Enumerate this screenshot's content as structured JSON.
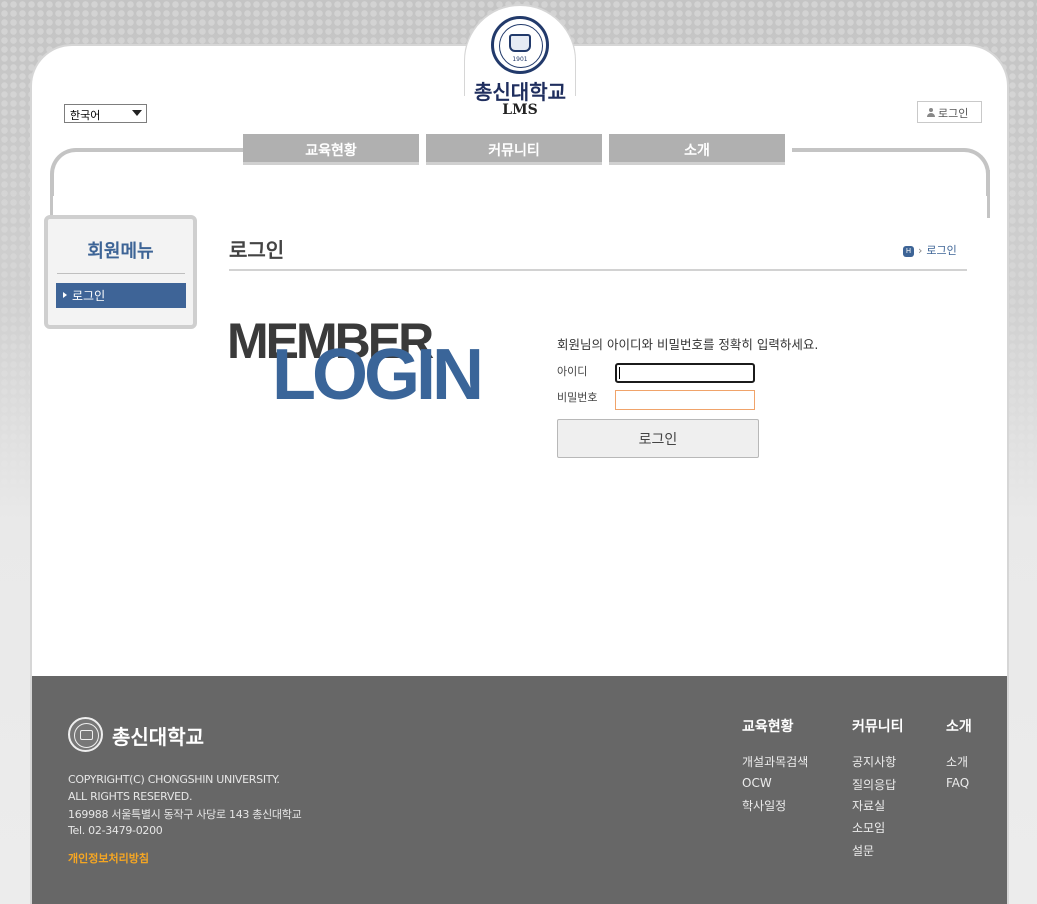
{
  "header": {
    "university_name": "총신대학교",
    "system_name": "LMS",
    "seal_year": "1901",
    "language_select": "한국어",
    "login_link": "로그인"
  },
  "nav": {
    "items": [
      {
        "label": "교육현황"
      },
      {
        "label": "커뮤니티"
      },
      {
        "label": "소개"
      }
    ]
  },
  "sidebar": {
    "title": "회원메뉴",
    "items": [
      {
        "label": "로그인",
        "active": true
      }
    ]
  },
  "content": {
    "title": "로그인",
    "breadcrumb_home": "H",
    "breadcrumb_current": "로그인",
    "hero_top": "MEMBER",
    "hero_bottom": "LOGIN",
    "instruction": "회원님의 아이디와 비밀번호를 정확히 입력하세요.",
    "id_label": "아이디",
    "id_value": "",
    "pw_label": "비밀번호",
    "pw_value": "",
    "login_button": "로그인"
  },
  "footer": {
    "university_name": "총신대학교",
    "copyright_1": "COPYRIGHT(C) CHONGSHIN UNIVERSITY.",
    "copyright_2": "ALL RIGHTS RESERVED.",
    "address": "169988 서울특별시 동작구 사당로 143 총신대학교",
    "tel": "Tel. 02-3479-0200",
    "privacy": "개인정보처리방침",
    "columns": [
      {
        "head": "교육현황",
        "links": [
          "개설과목검색",
          "OCW",
          "학사일정"
        ]
      },
      {
        "head": "커뮤니티",
        "links": [
          "공지사항",
          "질의응답",
          "자료실",
          "소모임",
          "설문"
        ]
      },
      {
        "head": "소개",
        "links": [
          "소개",
          "FAQ"
        ]
      }
    ]
  },
  "colors": {
    "brand_blue": "#3e6497",
    "navy": "#1f2e5e",
    "footer_bg": "#676767",
    "privacy_orange": "#f5a623"
  }
}
